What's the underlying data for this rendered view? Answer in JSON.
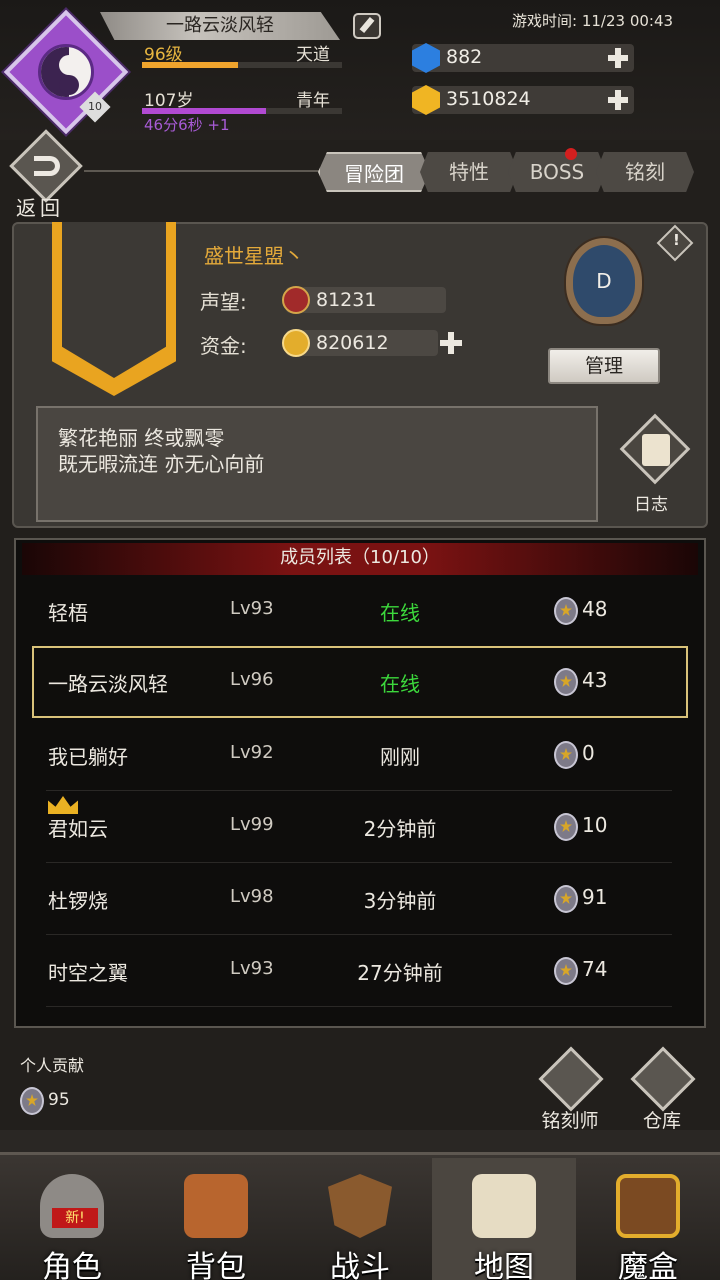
{
  "header": {
    "player_name": "一路云淡风轻",
    "avatar_level": "10",
    "level": "96级",
    "level_progress": 0.48,
    "path": "天道",
    "age": "107岁",
    "age_progress": 0.62,
    "age_stage": "青年",
    "age_timer": "46分6秒 +1",
    "game_time": "游戏时间: 11/23 00:43",
    "gems": "882",
    "gold": "3510824"
  },
  "back_label": "返回",
  "tabs": [
    "冒险团",
    "特性",
    "BOSS",
    "铭刻"
  ],
  "guild": {
    "name": "盛世星盟丶",
    "reputation_label": "声望:",
    "reputation": "81231",
    "funds_label": "资金:",
    "funds": "820612",
    "rank": "D",
    "manage_label": "管理",
    "motto_line1": "繁花艳丽 终或飘零",
    "motto_line2": "既无暇流连 亦无心向前",
    "log_label": "日志"
  },
  "members": {
    "title": "成员列表（10/10）",
    "rows": [
      {
        "name": "轻梧",
        "level": "Lv93",
        "status": "在线",
        "score": "48"
      },
      {
        "name": "一路云淡风轻",
        "level": "Lv96",
        "status": "在线",
        "score": "43"
      },
      {
        "name": "我已躺好",
        "level": "Lv92",
        "status": "刚刚",
        "score": "0"
      },
      {
        "name": "君如云",
        "level": "Lv99",
        "status": "2分钟前",
        "score": "10"
      },
      {
        "name": "杜锣烧",
        "level": "Lv98",
        "status": "3分钟前",
        "score": "91"
      },
      {
        "name": "时空之翼",
        "level": "Lv93",
        "status": "27分钟前",
        "score": "74"
      }
    ]
  },
  "contribution": {
    "label": "个人贡献",
    "value": "95"
  },
  "side_buttons": {
    "engraver": "铭刻师",
    "warehouse": "仓库"
  },
  "nav": {
    "items": [
      "角色",
      "背包",
      "战斗",
      "地图",
      "魔盒"
    ],
    "new_badge": "新!"
  },
  "colors": {
    "online": "#3cd83c",
    "accent_gold": "#e3a93a",
    "level_bar": "#f0a42d",
    "age_bar": "#b14ad2"
  }
}
